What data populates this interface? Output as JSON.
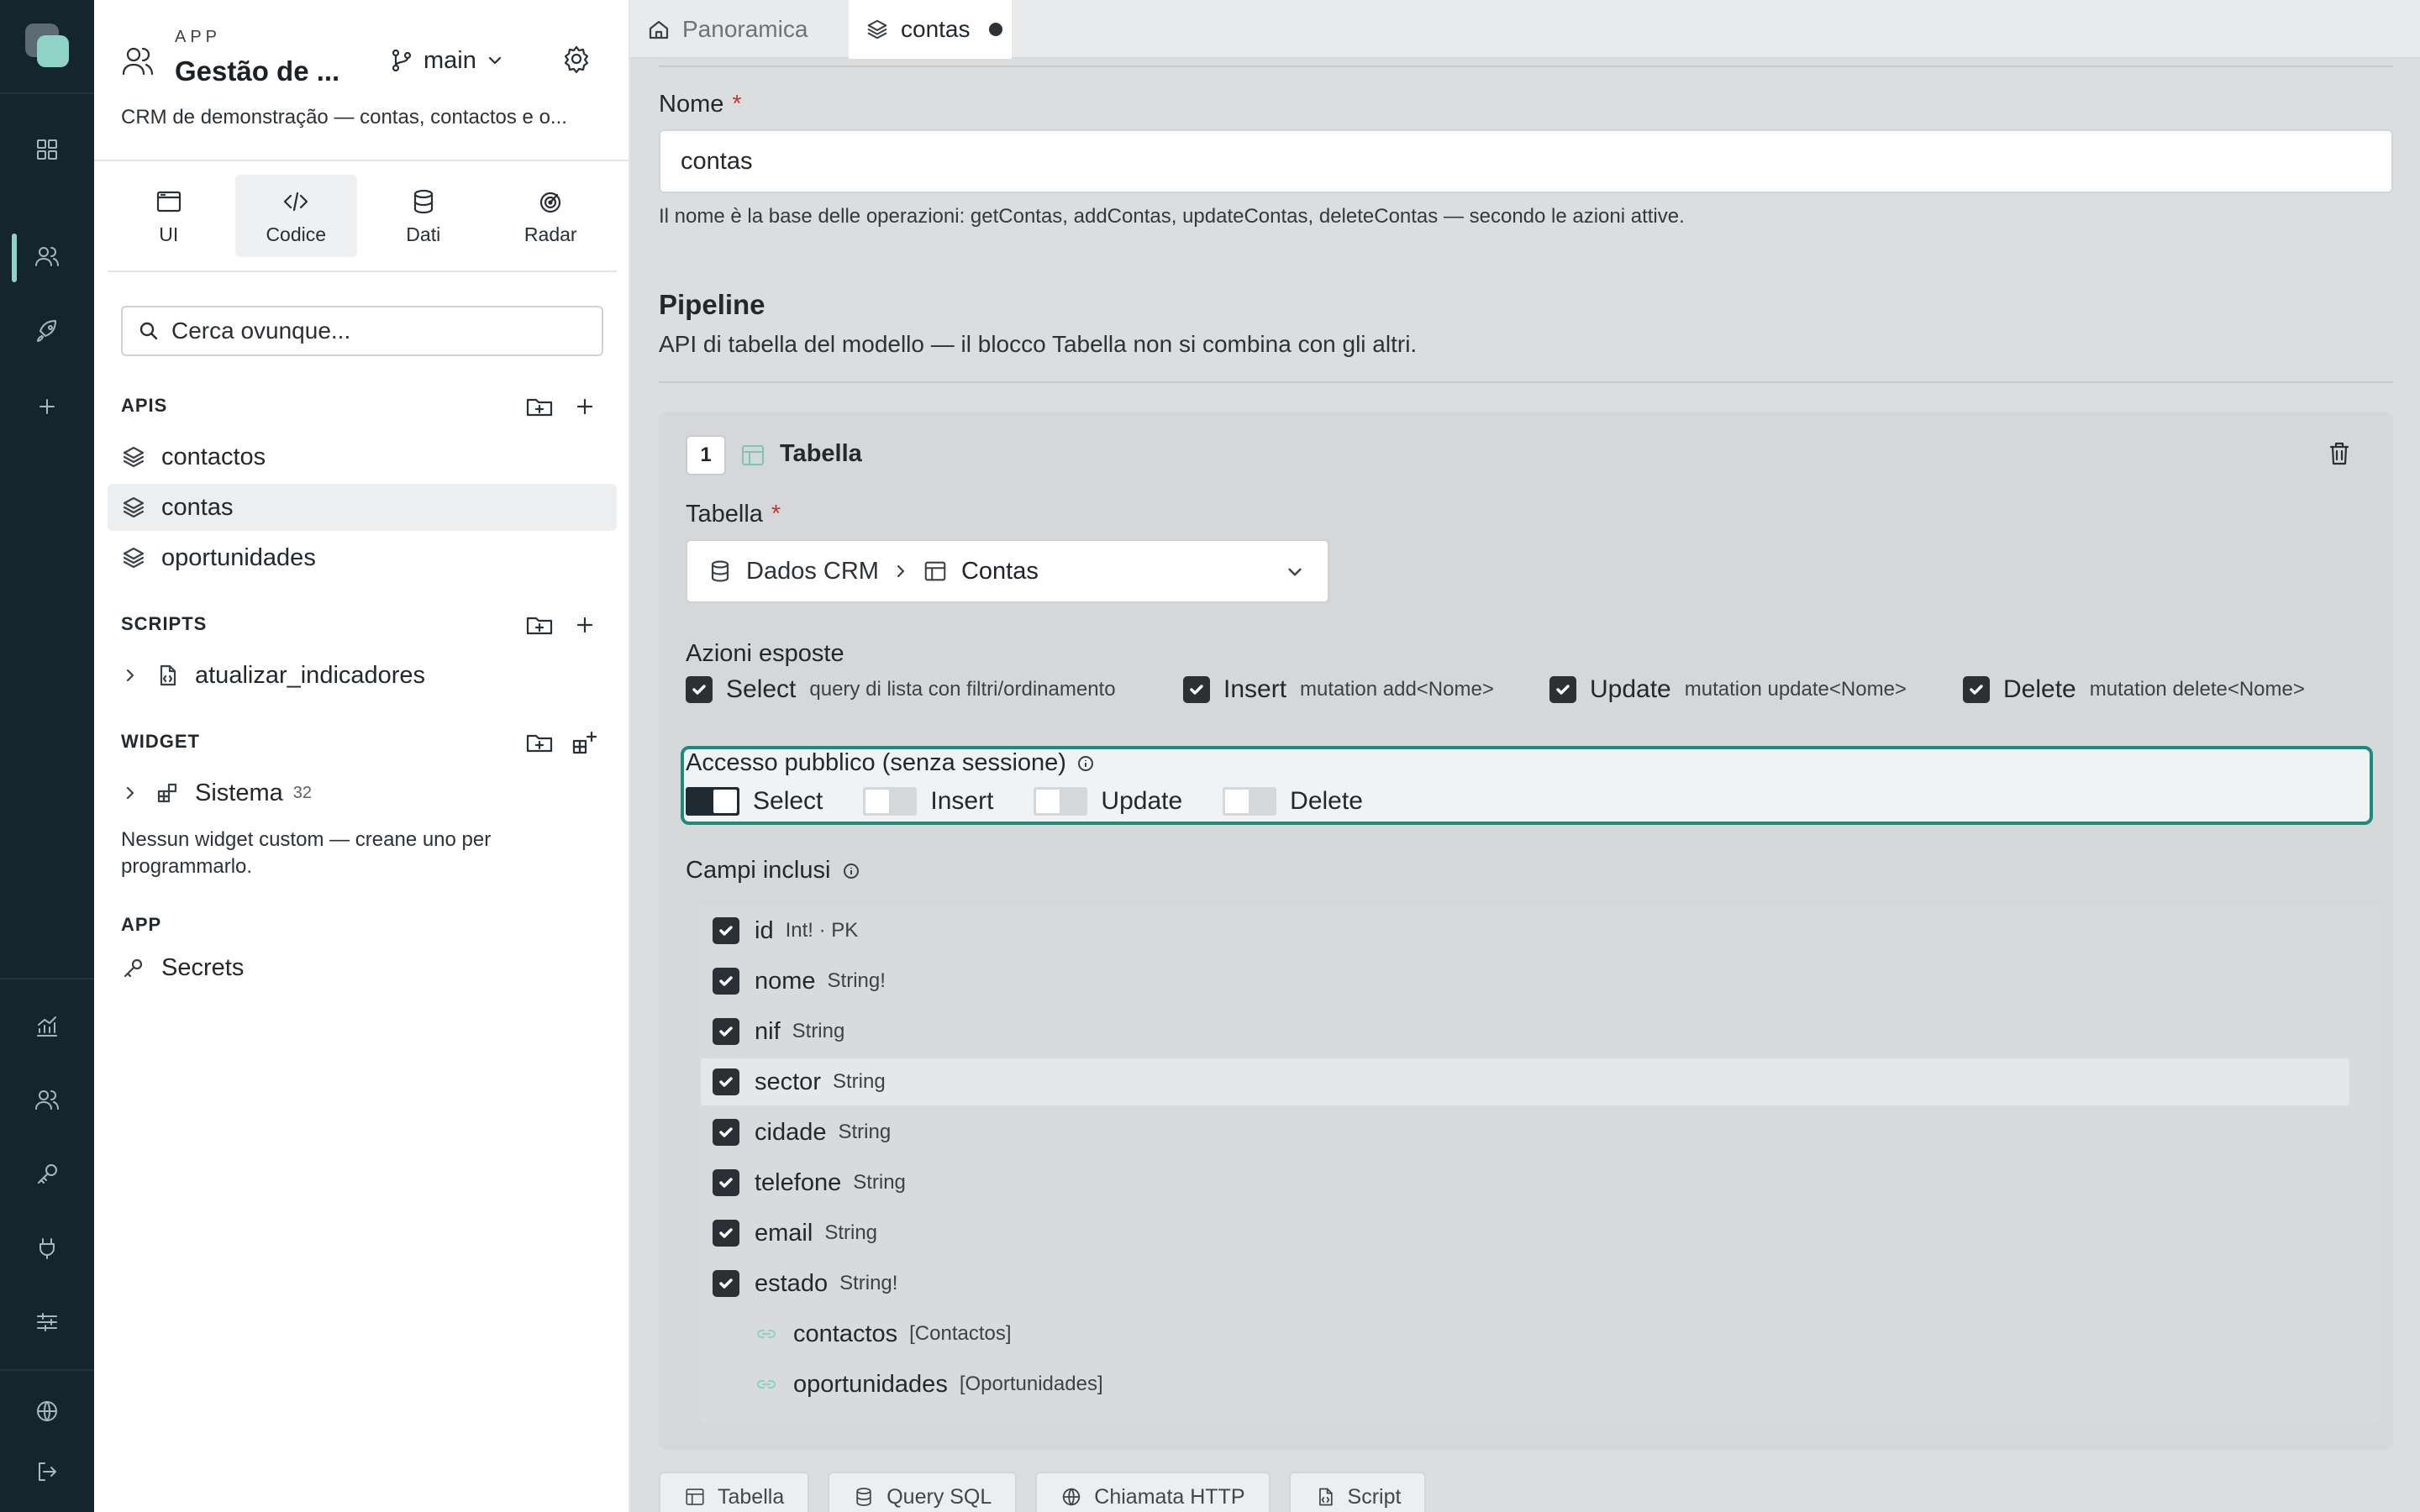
{
  "app": {
    "kicker": "APP",
    "title": "Gestão de ...",
    "branch": "main",
    "description": "CRM de demonstração — contas, contactos e o..."
  },
  "sidebar": {
    "tabs": [
      {
        "label": "UI",
        "icon": "browser-window-icon"
      },
      {
        "label": "Codice",
        "icon": "code-icon"
      },
      {
        "label": "Dati",
        "icon": "database-icon"
      },
      {
        "label": "Radar",
        "icon": "radar-icon"
      }
    ],
    "active_tab": "Codice",
    "search_placeholder": "Cerca ovunque...",
    "sections": {
      "apis": {
        "title": "APIS",
        "items": [
          "contactos",
          "contas",
          "oportunidades"
        ],
        "active": "contas"
      },
      "scripts": {
        "title": "SCRIPTS",
        "items": [
          "atualizar_indicadores"
        ]
      },
      "widget": {
        "title": "WIDGET",
        "group": "Sistema",
        "count": "32",
        "empty_note": "Nessun widget custom — creane uno per programmarlo."
      },
      "app": {
        "title": "APP",
        "items": [
          "Secrets"
        ]
      }
    }
  },
  "tabs": [
    {
      "label": "Panoramica",
      "icon": "home-icon"
    },
    {
      "label": "contas",
      "icon": "layers-icon",
      "unsaved": true
    }
  ],
  "form": {
    "name_label": "Nome",
    "required_mark": "*",
    "name_value": "contas",
    "name_hint": "Il nome è la base delle operazioni: getContas, addContas, updateContas, deleteContas — secondo le azioni attive.",
    "pipeline_title": "Pipeline",
    "pipeline_subtitle": "API di tabella del modello — il blocco Tabella non si combina con gli altri."
  },
  "block": {
    "step": "1",
    "title": "Tabella",
    "table_label": "Tabella",
    "table_source": "Dados CRM",
    "table_name": "Contas",
    "actions_label": "Azioni esposte",
    "actions": [
      {
        "name": "Select",
        "desc": "query di lista con filtri/ordinamento",
        "checked": true
      },
      {
        "name": "Insert",
        "desc": "mutation add<Nome>",
        "checked": true
      },
      {
        "name": "Update",
        "desc": "mutation update<Nome>",
        "checked": true
      },
      {
        "name": "Delete",
        "desc": "mutation delete<Nome>",
        "checked": true
      }
    ],
    "public_label": "Accesso pubblico (senza sessione)",
    "public_toggles": [
      {
        "name": "Select",
        "on": true
      },
      {
        "name": "Insert",
        "on": false
      },
      {
        "name": "Update",
        "on": false
      },
      {
        "name": "Delete",
        "on": false
      }
    ],
    "fields_label": "Campi inclusi",
    "fields": [
      {
        "name": "id",
        "type": "Int! · PK",
        "checked": true
      },
      {
        "name": "nome",
        "type": "String!",
        "checked": true
      },
      {
        "name": "nif",
        "type": "String",
        "checked": true
      },
      {
        "name": "sector",
        "type": "String",
        "checked": true
      },
      {
        "name": "cidade",
        "type": "String",
        "checked": true
      },
      {
        "name": "telefone",
        "type": "String",
        "checked": true
      },
      {
        "name": "email",
        "type": "String",
        "checked": true
      },
      {
        "name": "estado",
        "type": "String!",
        "checked": true
      },
      {
        "name": "contactos",
        "type": "[Contactos]",
        "relation": true
      },
      {
        "name": "oportunidades",
        "type": "[Oportunidades]",
        "relation": true
      }
    ]
  },
  "add_blocks": [
    "Tabella",
    "Query SQL",
    "Chiamata HTTP",
    "Script"
  ],
  "colors": {
    "accent": "#1e8a7e",
    "rail": "#15252e",
    "mint": "#8fd3c8",
    "required": "#c0392b"
  }
}
